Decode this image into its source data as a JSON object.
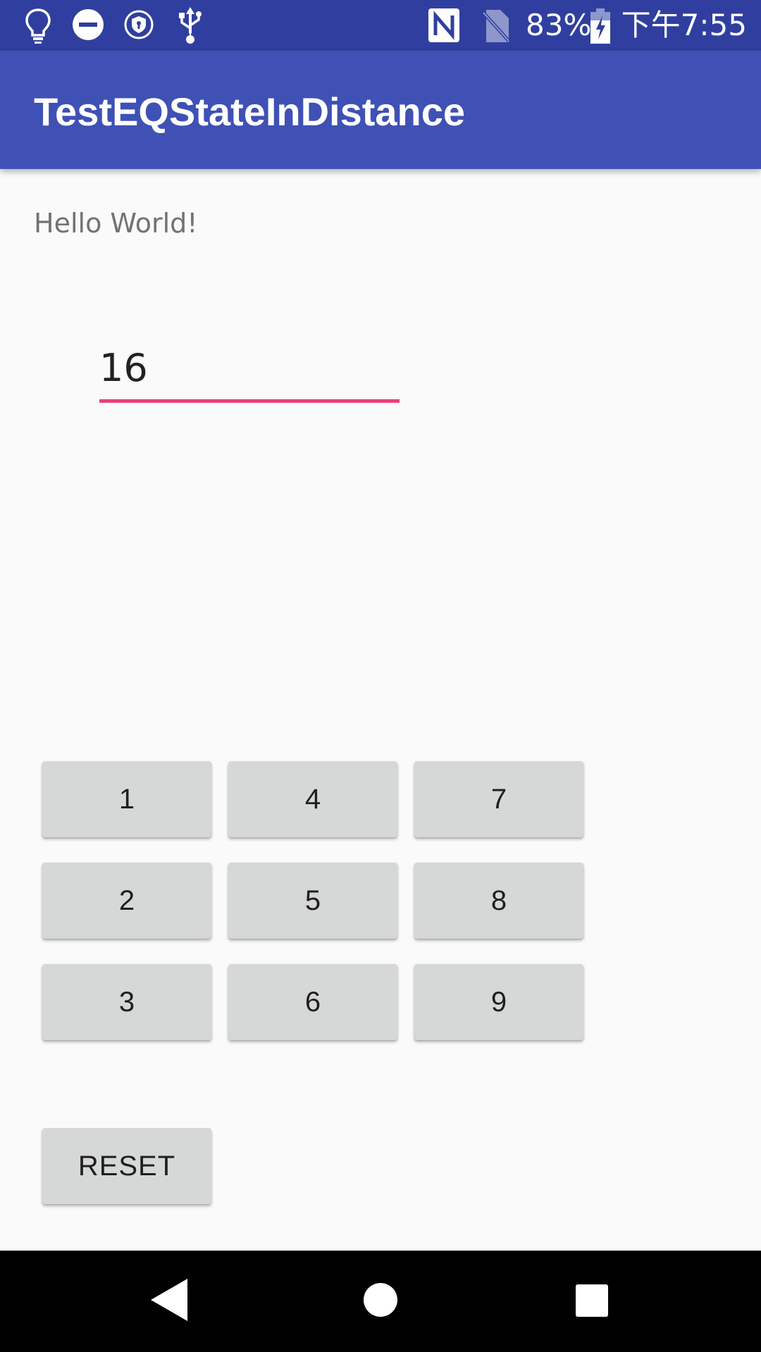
{
  "status_bar": {
    "battery_percent": "83%",
    "clock": "下午7:55",
    "icons": [
      "lightbulb-icon",
      "do-not-disturb-icon",
      "vpn-shield-icon",
      "usb-icon",
      "nfc-icon",
      "no-sim-icon",
      "battery-charging-icon"
    ]
  },
  "app_bar": {
    "title": "TestEQStateInDistance",
    "color": "#3f51b5"
  },
  "main": {
    "hello_text": "Hello World!",
    "number_input": {
      "value": "16",
      "underline_color": "#ec407a"
    },
    "keypad": {
      "buttons": [
        "1",
        "4",
        "7",
        "2",
        "5",
        "8",
        "3",
        "6",
        "9"
      ]
    },
    "reset_label": "RESET"
  },
  "nav_bar": {
    "icons": [
      "back-icon",
      "home-icon",
      "recents-icon"
    ]
  }
}
